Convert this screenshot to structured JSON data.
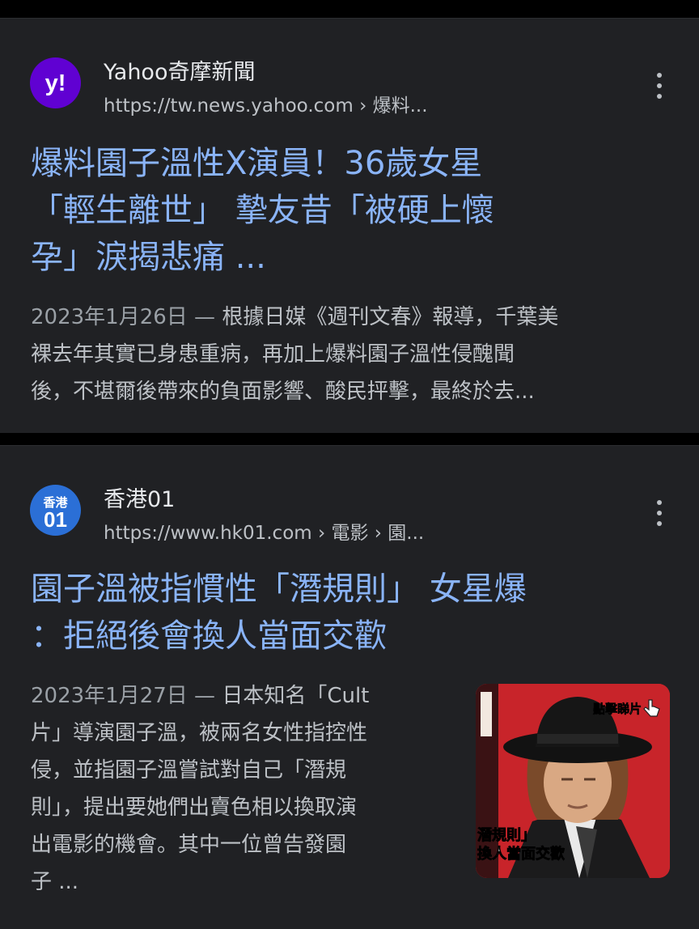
{
  "results": [
    {
      "site_name": "Yahoo奇摩新聞",
      "url": "https://tw.news.yahoo.com › 爆料...",
      "title_lines": [
        "爆料園子溫性X演員！36歲女星",
        "「輕生離世」 摯友昔「被硬上懷",
        "孕」淚揭悲痛 ..."
      ],
      "date": "2023年1月26日 —",
      "snippet_first": " 根據日媒《週刊文春》報導，千葉美",
      "snippet_lines": [
        "裸去年其實已身患重病，再加上爆料園子溫性侵醜聞",
        "後，不堪爾後帶來的負面影響、酸民抨擊，最終於去..."
      ],
      "logo_text": "y!",
      "logo_color": "#6001d2"
    },
    {
      "site_name": "香港01",
      "url": "https://www.hk01.com › 電影 › 園...",
      "title_lines": [
        "園子溫被指慣性「潛規則」 女星爆",
        "：拒絕後會換人當面交歡"
      ],
      "date": "2023年1月27日 —",
      "snippet_first": " 日本知名「Cult",
      "snippet_lines": [
        "片」導演園子溫，被兩名女性指控性",
        "侵，並指園子溫嘗試對自己「潛規",
        "則」，提出要她們出賣色相以換取演",
        "出電影的機會。其中一位曾告發園",
        "子 ..."
      ],
      "logo_text_top": "香港",
      "logo_text_bottom": "01",
      "logo_color": "#2b6fd6",
      "thumbnail": {
        "overlay_top": "點擊睇片",
        "overlay_bottom_1": "潛規則」",
        "overlay_bottom_2": "換人當面交歡",
        "background_color": "#c8242a"
      }
    }
  ],
  "icons": {
    "more": "more-vert-icon",
    "hand": "hand-pointer-icon"
  }
}
